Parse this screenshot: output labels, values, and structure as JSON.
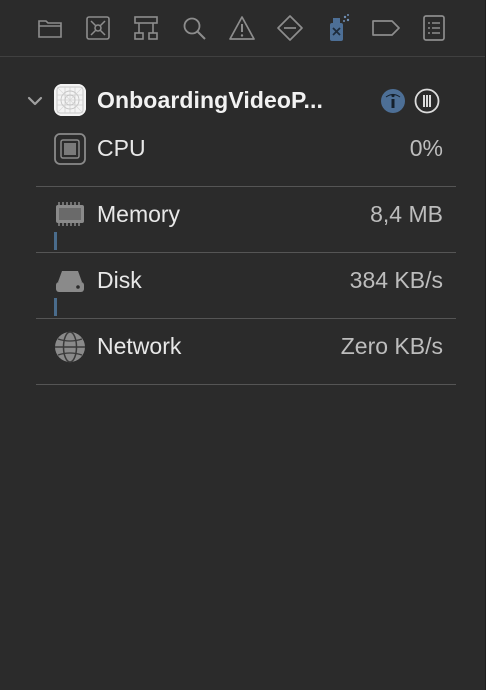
{
  "toolbar": {
    "icons": [
      {
        "name": "project-navigator-folder-icon",
        "label": "folder-icon"
      },
      {
        "name": "source-control-icon",
        "label": "source-control-icon"
      },
      {
        "name": "symbol-hierarchy-icon",
        "label": "hierarchy-icon"
      },
      {
        "name": "find-icon",
        "label": "search-icon"
      },
      {
        "name": "issue-warning-icon",
        "label": "warning-icon"
      },
      {
        "name": "test-diamond-icon",
        "label": "diamond-icon"
      },
      {
        "name": "debug-spray-icon",
        "label": "debug-icon"
      },
      {
        "name": "breakpoint-tag-icon",
        "label": "tag-icon"
      },
      {
        "name": "report-list-icon",
        "label": "report-icon"
      }
    ],
    "active_index": 6
  },
  "process": {
    "name": "OnboardingVideoP..."
  },
  "gauges": [
    {
      "label": "CPU",
      "value": "0%",
      "icon": "cpu-chip-icon"
    },
    {
      "label": "Memory",
      "value": "8,4 MB",
      "icon": "memory-module-icon"
    },
    {
      "label": "Disk",
      "value": "384 KB/s",
      "icon": "disk-drive-icon"
    },
    {
      "label": "Network",
      "value": "Zero KB/s",
      "icon": "network-globe-icon"
    }
  ],
  "colors": {
    "background": "#2b2b2b",
    "divider": "#555555",
    "accent_bar": "#4a6c8c",
    "info_button": "#4d6f96"
  }
}
